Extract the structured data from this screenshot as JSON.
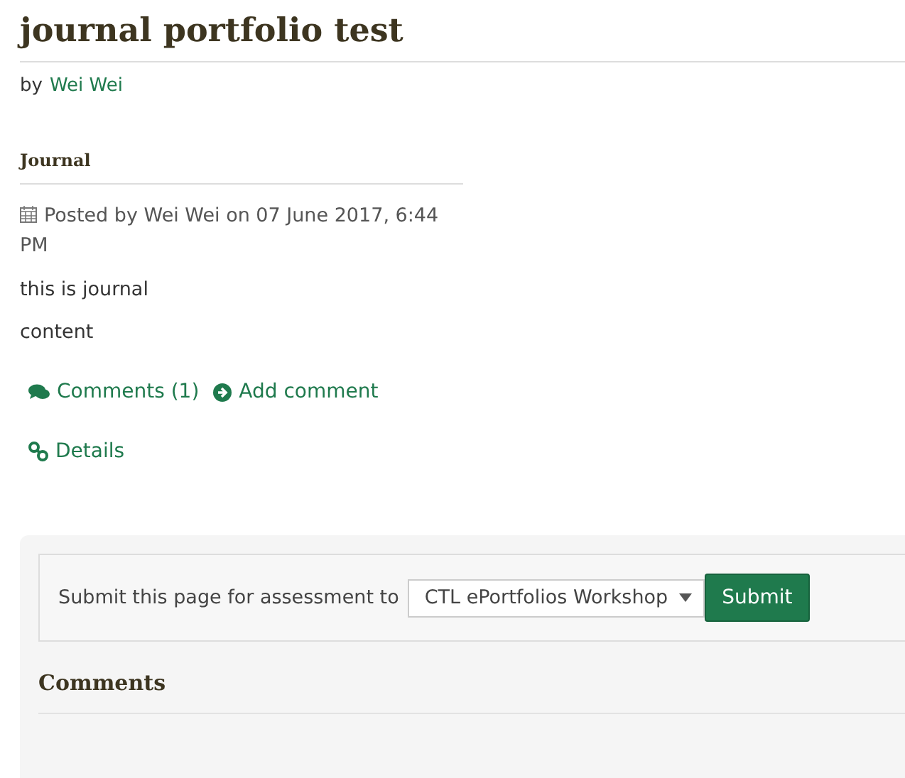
{
  "page": {
    "title": "journal portfolio test",
    "byline": {
      "prefix": "by",
      "author": "Wei Wei"
    }
  },
  "block": {
    "title": "Journal",
    "posted": "Posted by Wei Wei on 07 June 2017, 6:44 PM",
    "paragraphs": [
      "this is journal",
      "content"
    ],
    "links": [
      {
        "kind": "comments",
        "label": "Comments (1)"
      },
      {
        "kind": "add",
        "label": "Add comment"
      }
    ],
    "details": "Details"
  },
  "assessment": {
    "label": "Submit this page for assessment to",
    "select_value": "CTL ePortfolios Workshop",
    "button": "Submit"
  },
  "comments": {
    "title": "Comments"
  }
}
